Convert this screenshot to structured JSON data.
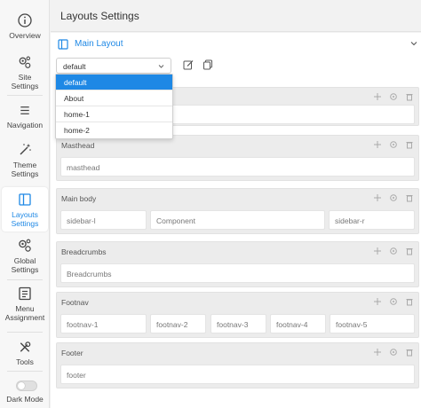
{
  "sidebar": {
    "items": [
      {
        "label": "Overview",
        "icon": "info-icon"
      },
      {
        "label": "Site Settings",
        "icon": "gears-icon"
      },
      {
        "label": "Navigation",
        "icon": "menu-icon"
      },
      {
        "label": "Theme Settings",
        "icon": "magic-wand-icon"
      },
      {
        "label": "Layouts Settings",
        "icon": "layout-icon"
      },
      {
        "label": "Global Settings",
        "icon": "gears-icon"
      },
      {
        "label": "Menu Assignment",
        "icon": "list-icon"
      },
      {
        "label": "Tools",
        "icon": "tools-icon"
      }
    ],
    "dark_mode_label": "Dark Mode"
  },
  "header": {
    "title": "Layouts Settings"
  },
  "panel": {
    "title": "Main Layout"
  },
  "layout_select": {
    "value": "default",
    "options": [
      "default",
      "About",
      "home-1",
      "home-2"
    ]
  },
  "rows": {
    "masthead": {
      "title": "Masthead",
      "cells": [
        "masthead"
      ]
    },
    "main_body": {
      "title": "Main body",
      "cells": [
        "sidebar-l",
        "Component",
        "sidebar-r"
      ]
    },
    "breadcrumbs": {
      "title": "Breadcrumbs",
      "cells": [
        "Breadcrumbs"
      ]
    },
    "footnav": {
      "title": "Footnav",
      "cells": [
        "footnav-1",
        "footnav-2",
        "footnav-3",
        "footnav-4",
        "footnav-5"
      ]
    },
    "footer": {
      "title": "Footer",
      "cells": [
        "footer"
      ]
    }
  },
  "colors": {
    "accent": "#1e88e5",
    "row_bg": "#ececec",
    "sidebar_bg": "#f7f7f7"
  }
}
